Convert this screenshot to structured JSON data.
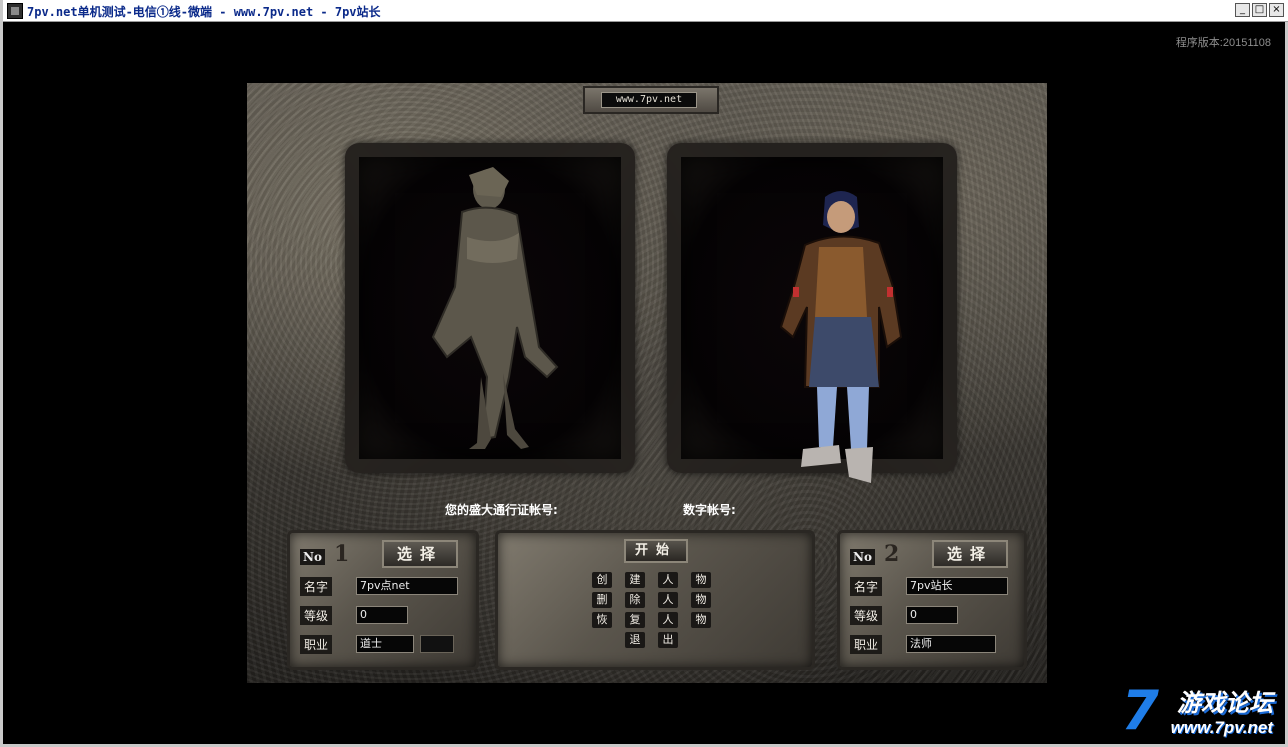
{
  "window": {
    "title": "7pv.net单机测试-电信①线-微端 - www.7pv.net - 7pv站长",
    "minimize_glyph": "_",
    "maximize_glyph": "□",
    "close_glyph": "×"
  },
  "version_text": "程序版本:20151108",
  "plaque_url": "www.7pv.net",
  "account": {
    "sdo_label": "您的盛大通行证帐号:",
    "numeric_label": "数字帐号:"
  },
  "slots": [
    {
      "no_label": "No",
      "number": "1",
      "select_label": "选择",
      "name_label": "名字",
      "name_value": "7pv点net",
      "level_label": "等级",
      "level_value": "0",
      "job_label": "职业",
      "job_value": "道士"
    },
    {
      "no_label": "No",
      "number": "2",
      "select_label": "选择",
      "name_label": "名字",
      "name_value": "7pv站长",
      "level_label": "等级",
      "level_value": "0",
      "job_label": "职业",
      "job_value": "法师"
    }
  ],
  "menu": {
    "start_label": "开始",
    "create_chars": [
      "创",
      "建",
      "人",
      "物"
    ],
    "delete_chars": [
      "删",
      "除",
      "人",
      "物"
    ],
    "restore_chars": [
      "恢",
      "复",
      "人",
      "物"
    ],
    "exit_chars": [
      "退",
      "出"
    ]
  },
  "watermark": {
    "seven": "7",
    "title": "游戏论坛",
    "url": "www.7pv.net"
  },
  "colors": {
    "title_text": "#0b2a8a",
    "watermark_blue": "#1f7de8"
  }
}
